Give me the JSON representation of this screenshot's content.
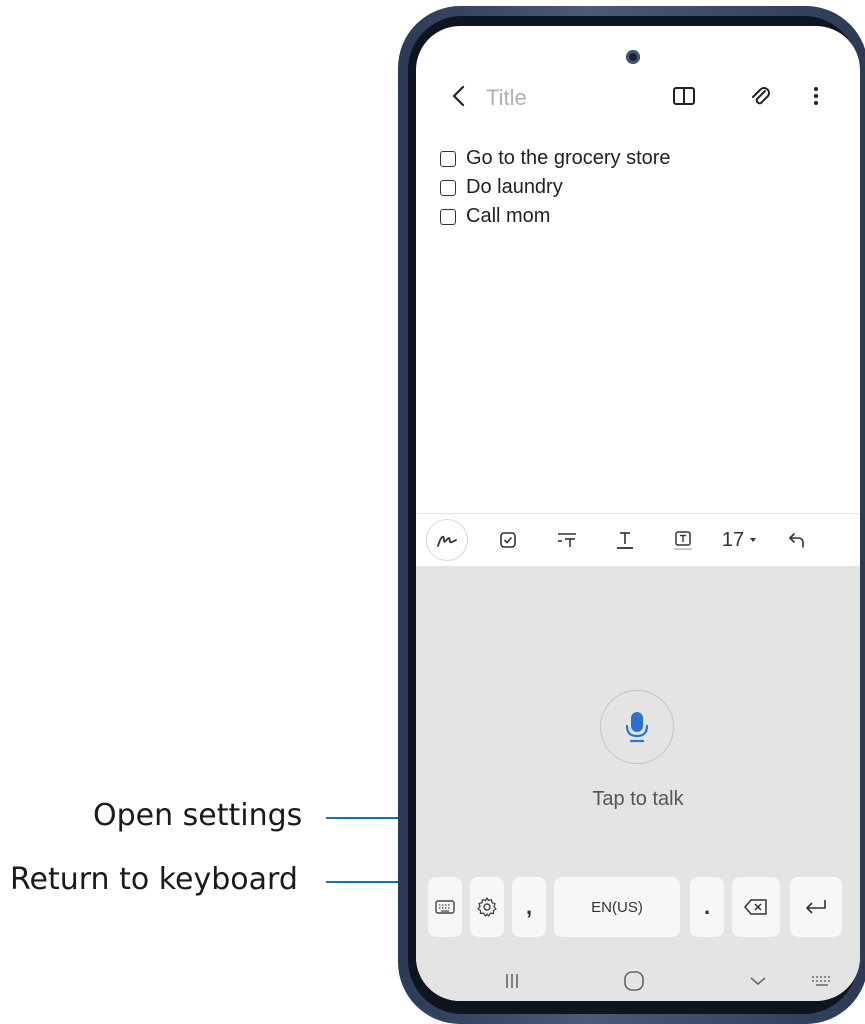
{
  "callouts": {
    "open_settings": "Open settings",
    "return_to_keyboard": "Return to keyboard"
  },
  "note": {
    "title_placeholder": "Title",
    "items": [
      "Go to the grocery store",
      "Do laundry",
      "Call mom"
    ]
  },
  "format_bar": {
    "font_size": "17",
    "icons": [
      "handwriting-icon",
      "checkbox-icon",
      "text-style-icon",
      "text-underline-icon",
      "text-highlight-icon",
      "font-size-dropdown",
      "undo-icon"
    ]
  },
  "voice_input": {
    "label": "Tap to talk"
  },
  "keyboard": {
    "language_key": "EN(US)",
    "comma": ",",
    "period": "."
  },
  "colors": {
    "accent": "#1b6db5",
    "keyboard_bg": "#e4e4e4",
    "mic_blue": "#2e6fd6"
  }
}
